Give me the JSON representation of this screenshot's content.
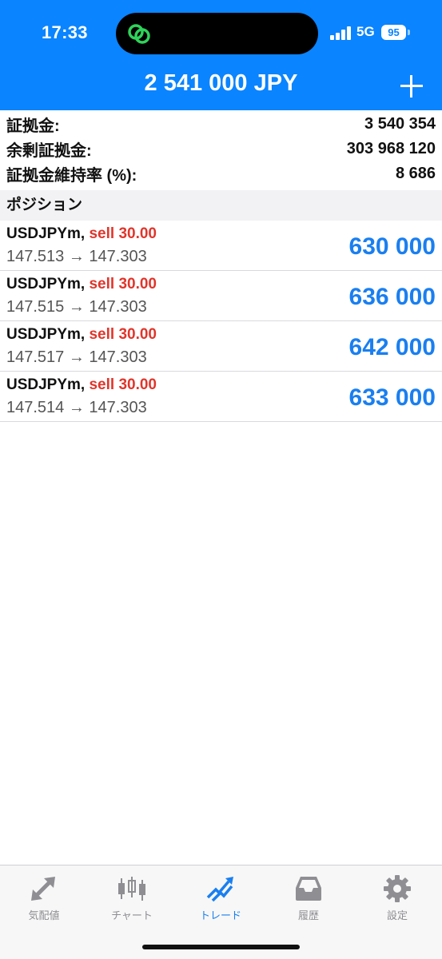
{
  "status": {
    "time": "17:33",
    "network": "5G",
    "battery": "95"
  },
  "header": {
    "title": "2 541 000 JPY"
  },
  "summary": [
    {
      "label": "証拠金:",
      "value": "3 540 354"
    },
    {
      "label": "余剰証拠金:",
      "value": "303 968 120"
    },
    {
      "label": "証拠金維持率 (%):",
      "value": "8 686"
    }
  ],
  "section_title": "ポジション",
  "positions": [
    {
      "symbol": "USDJPYm,",
      "side": "sell 30.00",
      "prices": "147.513 → 147.303",
      "profit": "630 000"
    },
    {
      "symbol": "USDJPYm,",
      "side": "sell 30.00",
      "prices": "147.515 → 147.303",
      "profit": "636 000"
    },
    {
      "symbol": "USDJPYm,",
      "side": "sell 30.00",
      "prices": "147.517 → 147.303",
      "profit": "642 000"
    },
    {
      "symbol": "USDJPYm,",
      "side": "sell 30.00",
      "prices": "147.514 → 147.303",
      "profit": "633 000"
    }
  ],
  "tabs": [
    {
      "label": "気配値",
      "icon": "quotes-arrows-icon"
    },
    {
      "label": "チャート",
      "icon": "candlestick-chart-icon"
    },
    {
      "label": "トレード",
      "icon": "trade-trend-icon",
      "active": true
    },
    {
      "label": "履歴",
      "icon": "history-inbox-icon"
    },
    {
      "label": "設定",
      "icon": "settings-gear-icon"
    }
  ],
  "colors": {
    "accent": "#0a84ff",
    "sell": "#e0352b",
    "profit": "#1a7ff0",
    "tab_inactive": "#8e8e93"
  }
}
